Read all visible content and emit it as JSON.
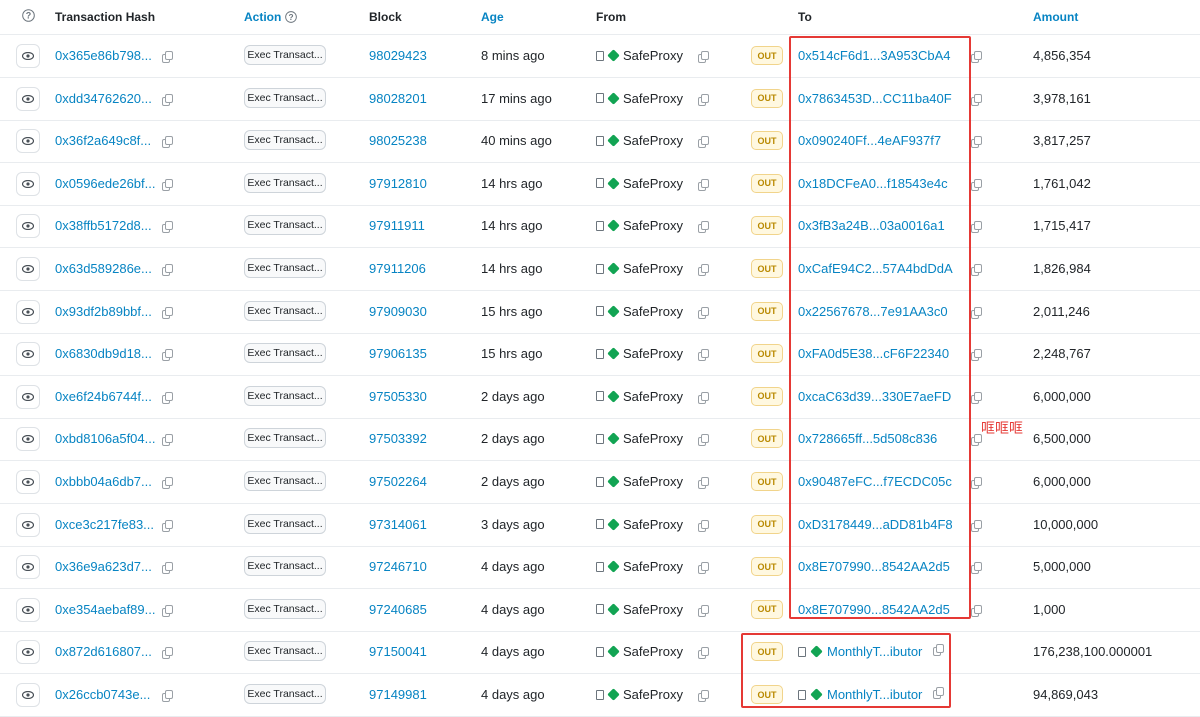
{
  "header": {
    "help_icon": "help-circle-icon",
    "transaction_hash": "Transaction Hash",
    "action": "Action",
    "block": "Block",
    "age": "Age",
    "from": "From",
    "to": "To",
    "amount": "Amount"
  },
  "colors": {
    "link": "#0784c3",
    "highlight": "#e53935",
    "out_badge_bg": "#fff8e0",
    "out_badge_text": "#b98900",
    "safe_icon": "#12a453"
  },
  "rows": [
    {
      "hash": "0x365e86b798...",
      "method": "Exec Transact...",
      "block": "98029423",
      "age": "8 mins ago",
      "from": "SafeProxy",
      "direction": "OUT",
      "to": "0x514cF6d1...3A953CbA4",
      "amount": "4,856,354"
    },
    {
      "hash": "0xdd34762620...",
      "method": "Exec Transact...",
      "block": "98028201",
      "age": "17 mins ago",
      "from": "SafeProxy",
      "direction": "OUT",
      "to": "0x7863453D...CC11ba40F",
      "amount": "3,978,161"
    },
    {
      "hash": "0x36f2a649c8f...",
      "method": "Exec Transact...",
      "block": "98025238",
      "age": "40 mins ago",
      "from": "SafeProxy",
      "direction": "OUT",
      "to": "0x090240Ff...4eAF937f7",
      "amount": "3,817,257"
    },
    {
      "hash": "0x0596ede26bf...",
      "method": "Exec Transact...",
      "block": "97912810",
      "age": "14 hrs ago",
      "from": "SafeProxy",
      "direction": "OUT",
      "to": "0x18DCFeA0...f18543e4c",
      "amount": "1,761,042"
    },
    {
      "hash": "0x38ffb5172d8...",
      "method": "Exec Transact...",
      "block": "97911911",
      "age": "14 hrs ago",
      "from": "SafeProxy",
      "direction": "OUT",
      "to": "0x3fB3a24B...03a0016a1",
      "amount": "1,715,417"
    },
    {
      "hash": "0x63d589286e...",
      "method": "Exec Transact...",
      "block": "97911206",
      "age": "14 hrs ago",
      "from": "SafeProxy",
      "direction": "OUT",
      "to": "0xCafE94C2...57A4bdDdA",
      "amount": "1,826,984"
    },
    {
      "hash": "0x93df2b89bbf...",
      "method": "Exec Transact...",
      "block": "97909030",
      "age": "15 hrs ago",
      "from": "SafeProxy",
      "direction": "OUT",
      "to": "0x22567678...7e91AA3c0",
      "amount": "2,011,246"
    },
    {
      "hash": "0x6830db9d18...",
      "method": "Exec Transact...",
      "block": "97906135",
      "age": "15 hrs ago",
      "from": "SafeProxy",
      "direction": "OUT",
      "to": "0xFA0d5E38...cF6F22340",
      "amount": "2,248,767"
    },
    {
      "hash": "0xe6f24b6744f...",
      "method": "Exec Transact...",
      "block": "97505330",
      "age": "2 days ago",
      "from": "SafeProxy",
      "direction": "OUT",
      "to": "0xcaC63d39...330E7aeFD",
      "amount": "6,000,000"
    },
    {
      "hash": "0xbd8106a5f04...",
      "method": "Exec Transact...",
      "block": "97503392",
      "age": "2 days ago",
      "from": "SafeProxy",
      "direction": "OUT",
      "to": "0x728665ff...5d508c836",
      "amount": "6,500,000"
    },
    {
      "hash": "0xbbb04a6db7...",
      "method": "Exec Transact...",
      "block": "97502264",
      "age": "2 days ago",
      "from": "SafeProxy",
      "direction": "OUT",
      "to": "0x90487eFC...f7ECDC05c",
      "amount": "6,000,000"
    },
    {
      "hash": "0xce3c217fe83...",
      "method": "Exec Transact...",
      "block": "97314061",
      "age": "3 days ago",
      "from": "SafeProxy",
      "direction": "OUT",
      "to": "0xD3178449...aDD81b4F8",
      "amount": "10,000,000"
    },
    {
      "hash": "0x36e9a623d7...",
      "method": "Exec Transact...",
      "block": "97246710",
      "age": "4 days ago",
      "from": "SafeProxy",
      "direction": "OUT",
      "to": "0x8E707990...8542AA2d5",
      "amount": "5,000,000"
    },
    {
      "hash": "0xe354aebaf89...",
      "method": "Exec Transact...",
      "block": "97240685",
      "age": "4 days ago",
      "from": "SafeProxy",
      "direction": "OUT",
      "to": "0x8E707990...8542AA2d5",
      "amount": "1,000"
    },
    {
      "hash": "0x872d616807...",
      "method": "Exec Transact...",
      "block": "97150041",
      "age": "4 days ago",
      "from": "SafeProxy",
      "direction": "OUT",
      "to": "MonthlyT...ibutor",
      "amount": "176,238,100.000001"
    },
    {
      "hash": "0x26ccb0743e...",
      "method": "Exec Transact...",
      "block": "97149981",
      "age": "4 days ago",
      "from": "SafeProxy",
      "direction": "OUT",
      "to": "MonthlyT...ibutor",
      "amount": "94,869,043"
    }
  ],
  "annotation": "哐哐哐"
}
